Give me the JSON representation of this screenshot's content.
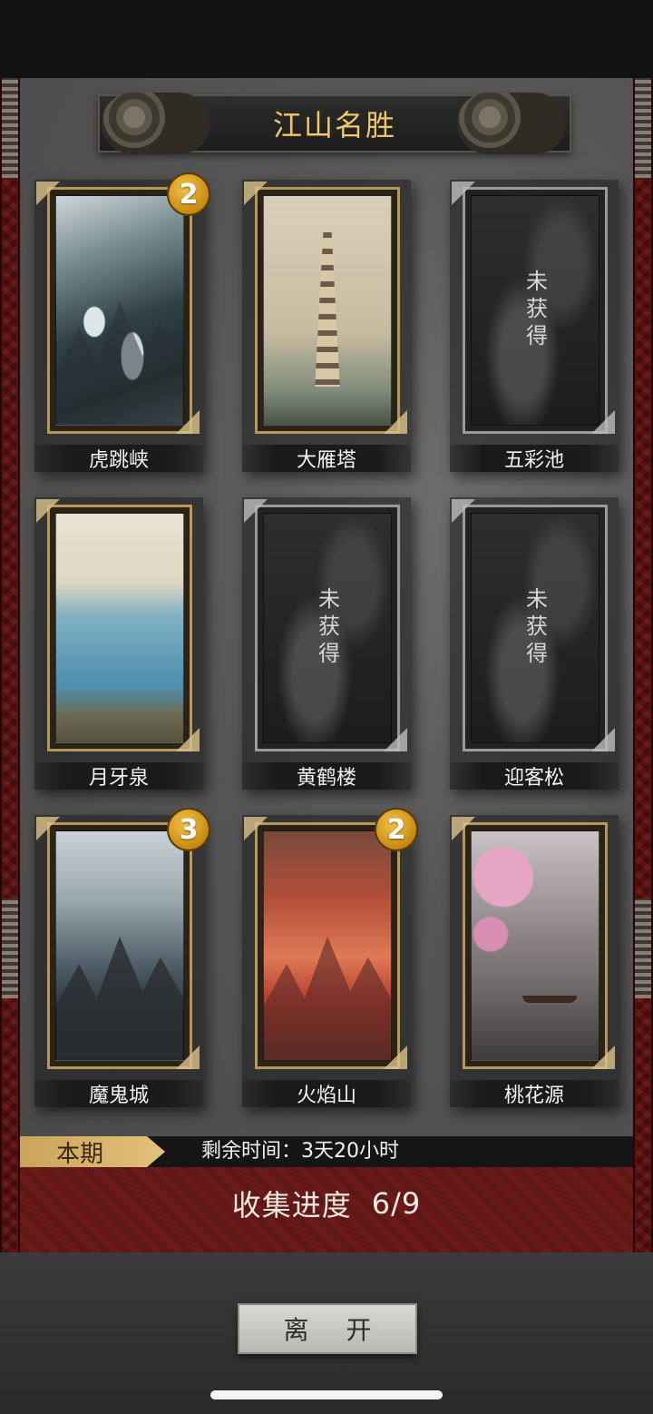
{
  "title": "江山名胜",
  "locked_label": "未获得",
  "cards": [
    {
      "name": "虎跳峡",
      "count": "2",
      "owned": true,
      "art": "art-hutiao"
    },
    {
      "name": "大雁塔",
      "count": "",
      "owned": true,
      "art": "art-dayan"
    },
    {
      "name": "五彩池",
      "count": "",
      "owned": false,
      "art": "art-locked"
    },
    {
      "name": "月牙泉",
      "count": "",
      "owned": true,
      "art": "art-yueya"
    },
    {
      "name": "黄鹤楼",
      "count": "",
      "owned": false,
      "art": "art-locked"
    },
    {
      "name": "迎客松",
      "count": "",
      "owned": false,
      "art": "art-locked"
    },
    {
      "name": "魔鬼城",
      "count": "3",
      "owned": true,
      "art": "art-mogui"
    },
    {
      "name": "火焰山",
      "count": "2",
      "owned": true,
      "art": "art-huoyan"
    },
    {
      "name": "桃花源",
      "count": "",
      "owned": true,
      "art": "art-taohua"
    }
  ],
  "period": {
    "tag": "本期",
    "remaining": "剩余时间：3天20小时"
  },
  "progress": {
    "label": "收集进度",
    "value": "6/9"
  },
  "leave_button": "离 开",
  "colors": {
    "gold": "#f0c868",
    "badge": "#e0a020",
    "border_red": "#5a1010",
    "progress_bg": "#6a1a18"
  }
}
